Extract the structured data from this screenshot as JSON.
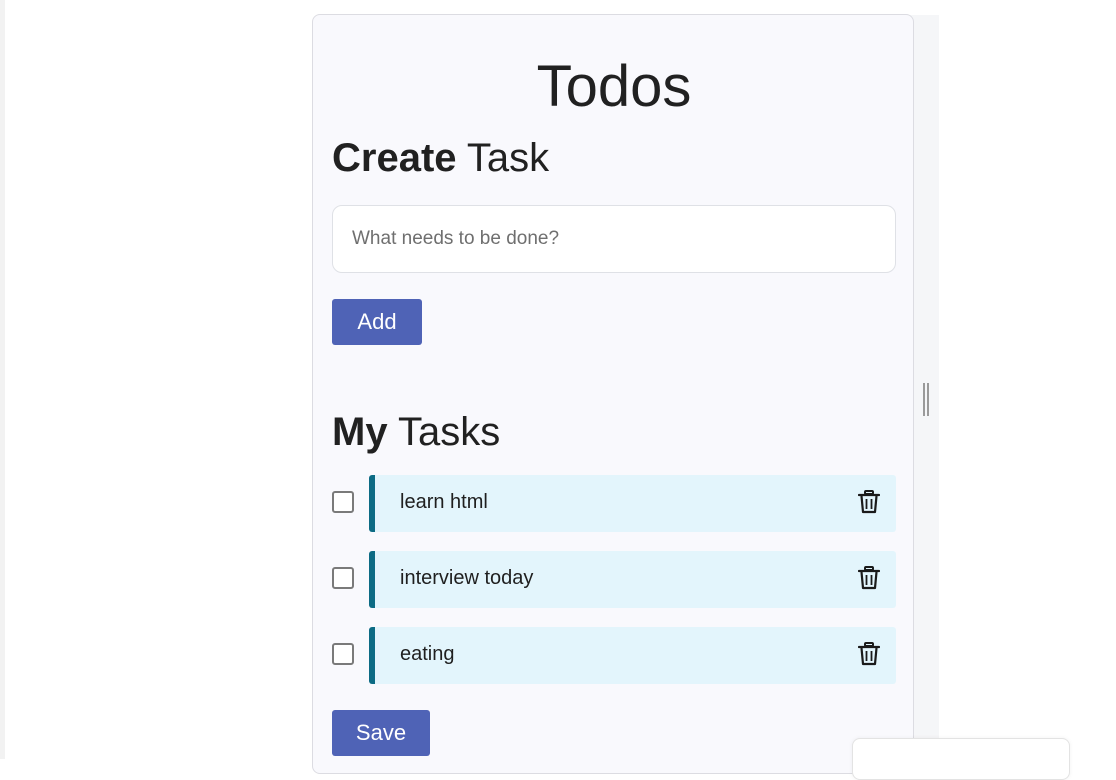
{
  "app": {
    "title": "Todos"
  },
  "create": {
    "heading_bold": "Create",
    "heading_rest": " Task",
    "input_placeholder": "What needs to be done?",
    "input_value": "",
    "add_label": "Add"
  },
  "tasks": {
    "heading_bold": "My",
    "heading_rest": " Tasks",
    "items": [
      {
        "label": "learn html",
        "checked": false
      },
      {
        "label": "interview today",
        "checked": false
      },
      {
        "label": "eating",
        "checked": false
      }
    ],
    "save_label": "Save"
  },
  "icons": {
    "delete": "trash-icon"
  },
  "colors": {
    "button": "#4f63b6",
    "task_bg": "#e3f5fc",
    "task_accent": "#0c6b84",
    "card_bg": "#f9f9fd"
  }
}
